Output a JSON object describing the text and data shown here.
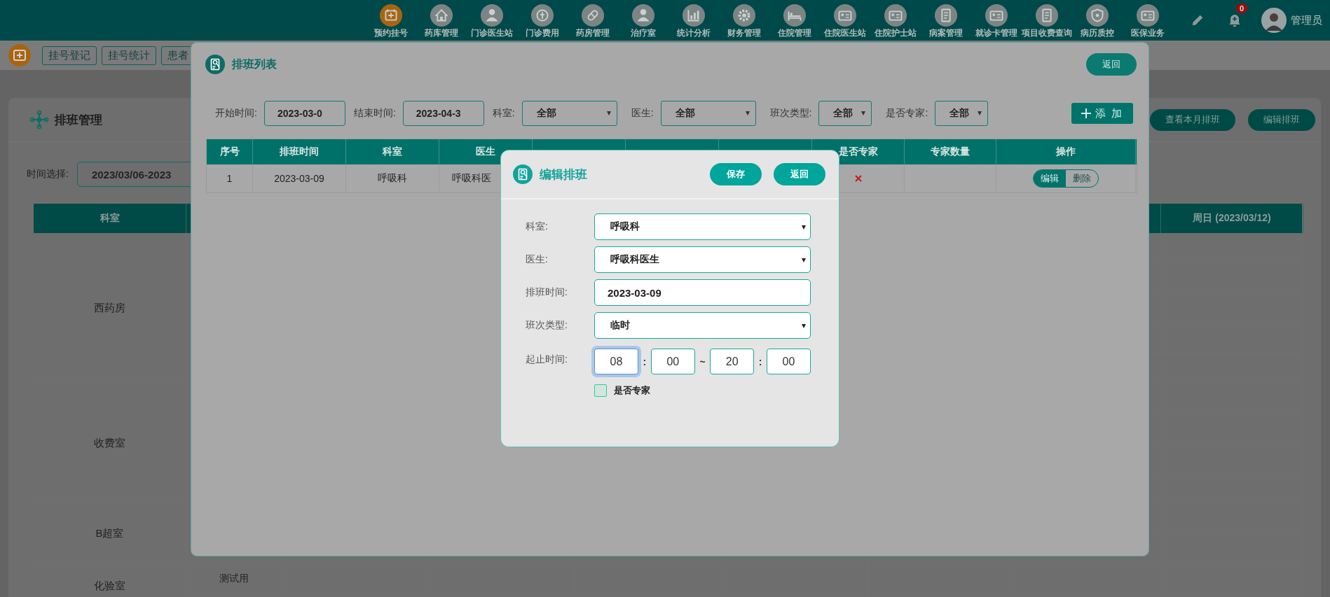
{
  "top_nav": {
    "items": [
      {
        "label": "预约挂号",
        "selected": true
      },
      {
        "label": "药库管理",
        "selected": false
      },
      {
        "label": "门诊医生站",
        "selected": false
      },
      {
        "label": "门诊费用",
        "selected": false
      },
      {
        "label": "药房管理",
        "selected": false
      },
      {
        "label": "治疗室",
        "selected": false
      },
      {
        "label": "统计分析",
        "selected": false
      },
      {
        "label": "财务管理",
        "selected": false
      },
      {
        "label": "住院管理",
        "selected": false
      },
      {
        "label": "住院医生站",
        "selected": false
      },
      {
        "label": "住院护士站",
        "selected": false
      },
      {
        "label": "病案管理",
        "selected": false
      },
      {
        "label": "就诊卡管理",
        "selected": false
      },
      {
        "label": "项目收费查询",
        "selected": false
      },
      {
        "label": "病历质控",
        "selected": false
      },
      {
        "label": "医保业务",
        "selected": false
      }
    ],
    "notification_count": "0",
    "user_name": "管理员"
  },
  "sub_tabs": [
    {
      "label": "挂号登记"
    },
    {
      "label": "挂号统计"
    },
    {
      "label": "患者"
    }
  ],
  "schedule_panel": {
    "title": "排班管理",
    "buttons": [
      "查看本月排班",
      "编辑排班"
    ],
    "date_label": "时间选择:",
    "date_value": "2023/03/06-2023",
    "table": {
      "columns": [
        "科室",
        "周日 (2023/03/12)"
      ],
      "row_groups": [
        {
          "department": "西药房"
        },
        {
          "department": "收费室"
        },
        {
          "department": "B超室"
        },
        {
          "department": "化验室",
          "column_2": "测试用"
        }
      ]
    }
  },
  "schedule_list_dialog": {
    "title": "排班列表",
    "back_button": "返回",
    "filters": [
      {
        "kind": "input",
        "label": "开始时间:",
        "value": "2023-03-0"
      },
      {
        "kind": "input",
        "label": "结束时间:",
        "value": "2023-04-3"
      },
      {
        "kind": "select",
        "label": "科室:",
        "value": "全部"
      },
      {
        "kind": "select",
        "label": "医生:",
        "value": "全部"
      },
      {
        "kind": "select",
        "label": "班次类型:",
        "value": "全部"
      },
      {
        "kind": "select",
        "label": "是否专家:",
        "value": "全部"
      }
    ],
    "add_button": "添 加",
    "table": {
      "columns": [
        "序号",
        "排班时间",
        "科室",
        "医生",
        "是否专家",
        "专家数量",
        "操作"
      ],
      "rows": [
        {
          "cells": [
            "1",
            "2023-03-09",
            "呼吸科",
            "呼吸科医"
          ],
          "expert": false,
          "actions": [
            {
              "label": "编辑",
              "selected": true
            },
            {
              "label": "删除",
              "selected": false
            }
          ]
        }
      ]
    }
  },
  "edit_dialog": {
    "title": "编辑排班",
    "buttons": [
      "保存",
      "返回"
    ],
    "fields": [
      {
        "kind": "select",
        "label": "科室:",
        "value": "呼吸科"
      },
      {
        "kind": "select",
        "label": "医生:",
        "value": "呼吸科医生"
      },
      {
        "kind": "input",
        "label": "排班时间:",
        "value": "2023-03-09"
      },
      {
        "kind": "select",
        "label": "班次类型:",
        "value": "临时"
      },
      {
        "kind": "time_range",
        "label": "起止时间:",
        "parts": [
          {
            "kind": "box",
            "value": "08",
            "focused": true
          },
          {
            "kind": "separator",
            "text": ":"
          },
          {
            "kind": "box",
            "value": "00",
            "focused": false
          },
          {
            "kind": "separator",
            "text": "~"
          },
          {
            "kind": "box",
            "value": "20",
            "focused": false
          },
          {
            "kind": "separator",
            "text": ":"
          },
          {
            "kind": "box",
            "value": "00",
            "focused": false
          }
        ]
      }
    ],
    "expert_checkbox": {
      "label": "是否专家",
      "checked": false
    }
  }
}
